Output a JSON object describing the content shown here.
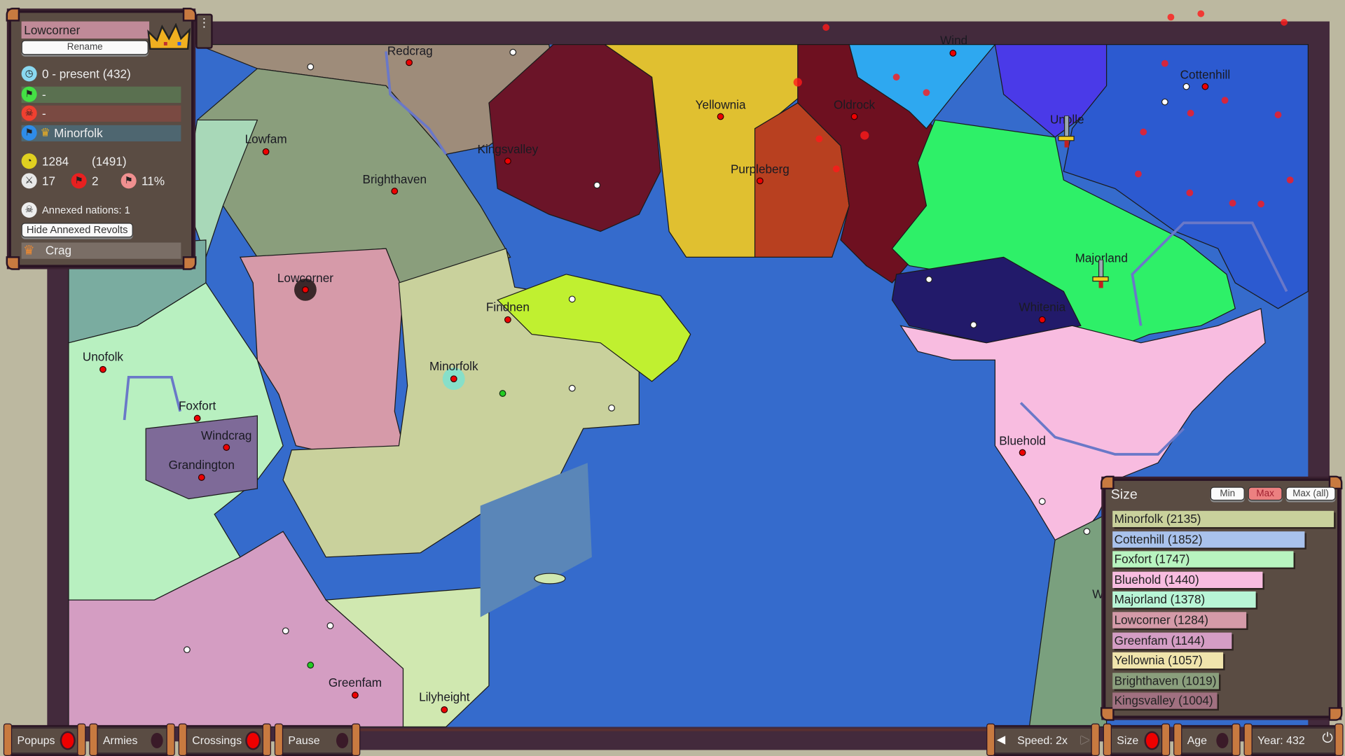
{
  "nation_panel": {
    "name": "Lowcorner",
    "rename_label": "Rename",
    "age_text": "0 - present (432)",
    "allies_text": "-",
    "enemies_text": "-",
    "overlord_text": "Minorfolk",
    "population": "1284",
    "population_max": "(1491)",
    "armies": "17",
    "revolts": "2",
    "revolt_pct": "11%",
    "annexed_text": "Annexed nations: 1",
    "hide_annexed_label": "Hide Annexed Revolts",
    "annexed_items": [
      "Crag"
    ]
  },
  "map": {
    "ocean_color": "#356bcc",
    "cities": [
      "Redcrag",
      "Wind",
      "Cottenhill",
      "Yellownia",
      "Oldrock",
      "Unolle",
      "Kingsvalley",
      "Lowfam",
      "Brighthaven",
      "Purpleberg",
      "Majorland",
      "Lowcorner",
      "Findnen",
      "Whitenia",
      "Unofolk",
      "Minorfolk",
      "Foxfort",
      "Windcrag",
      "Grandington",
      "Bluehold",
      "Greenfam",
      "Lilyheight",
      "W"
    ]
  },
  "size_panel": {
    "title": "Size",
    "buttons": [
      "Min",
      "Max",
      "Max (all)"
    ],
    "active_button": "Max",
    "entries": [
      {
        "label": "Minorfolk (2135)",
        "value": 2135,
        "color": "#c9d19c"
      },
      {
        "label": "Cottenhill (1852)",
        "value": 1852,
        "color": "#a9c2ec"
      },
      {
        "label": "Foxfort (1747)",
        "value": 1747,
        "color": "#b8f4c0"
      },
      {
        "label": "Bluehold (1440)",
        "value": 1440,
        "color": "#f8bce0"
      },
      {
        "label": "Majorland (1378)",
        "value": 1378,
        "color": "#b8f5d6"
      },
      {
        "label": "Lowcorner (1284)",
        "value": 1284,
        "color": "#d49aa8"
      },
      {
        "label": "Greenfam (1144)",
        "value": 1144,
        "color": "#d49dc4"
      },
      {
        "label": "Yellownia (1057)",
        "value": 1057,
        "color": "#f0e4ac"
      },
      {
        "label": "Brighthaven (1019)",
        "value": 1019,
        "color": "#8a9e7c"
      },
      {
        "label": "Kingsvalley (1004)",
        "value": 1004,
        "color": "#a07080"
      }
    ]
  },
  "bottom_bar": {
    "popups": {
      "label": "Popups",
      "on": true
    },
    "armies": {
      "label": "Armies",
      "on": false
    },
    "crossings": {
      "label": "Crossings",
      "on": true
    },
    "pause": {
      "label": "Pause",
      "on": false
    },
    "speed": "Speed: 2x",
    "size": {
      "label": "Size",
      "on": true
    },
    "age": {
      "label": "Age",
      "on": false
    },
    "year": "Year: 432"
  }
}
